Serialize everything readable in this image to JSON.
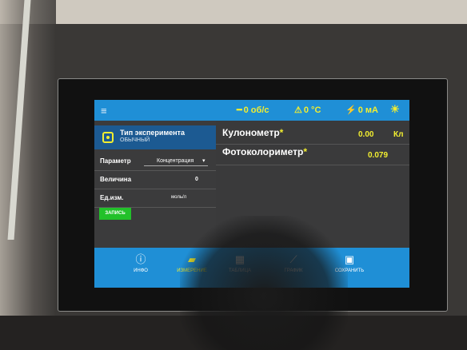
{
  "topbar": {
    "menu_icon": "menu-icon",
    "speed": "0 об/с",
    "temperature": "0 °C",
    "current": "0 мА",
    "colors": {
      "accent": "#1f8fd6",
      "status_text": "#f2ee30"
    }
  },
  "experiment": {
    "title": "Тип эксперимента",
    "subtitle": "ОБЫЧНЫЙ"
  },
  "params": {
    "parameter_label": "Параметр",
    "parameter_value": "Концентрация",
    "quantity_label": "Величина",
    "quantity_value": "0",
    "unit_label": "Ед.изм.",
    "unit_value": "моль/л"
  },
  "record_button": "ЗАПИСЬ",
  "measurements": [
    {
      "name": "Кулонометр",
      "value": "0.00",
      "unit": "Кл"
    },
    {
      "name": "Фотоколориметр",
      "value": "0.079",
      "unit": ""
    }
  ],
  "nav": [
    {
      "label": "ИНФО",
      "icon": "info-icon"
    },
    {
      "label": "ИЗМЕРЕНИЕ",
      "icon": "ruler-icon"
    },
    {
      "label": "ТАБЛИЦА",
      "icon": "table-icon"
    },
    {
      "label": "ГРАФИК",
      "icon": "chart-icon"
    },
    {
      "label": "СОХРАНИТЬ",
      "icon": "save-icon"
    }
  ]
}
